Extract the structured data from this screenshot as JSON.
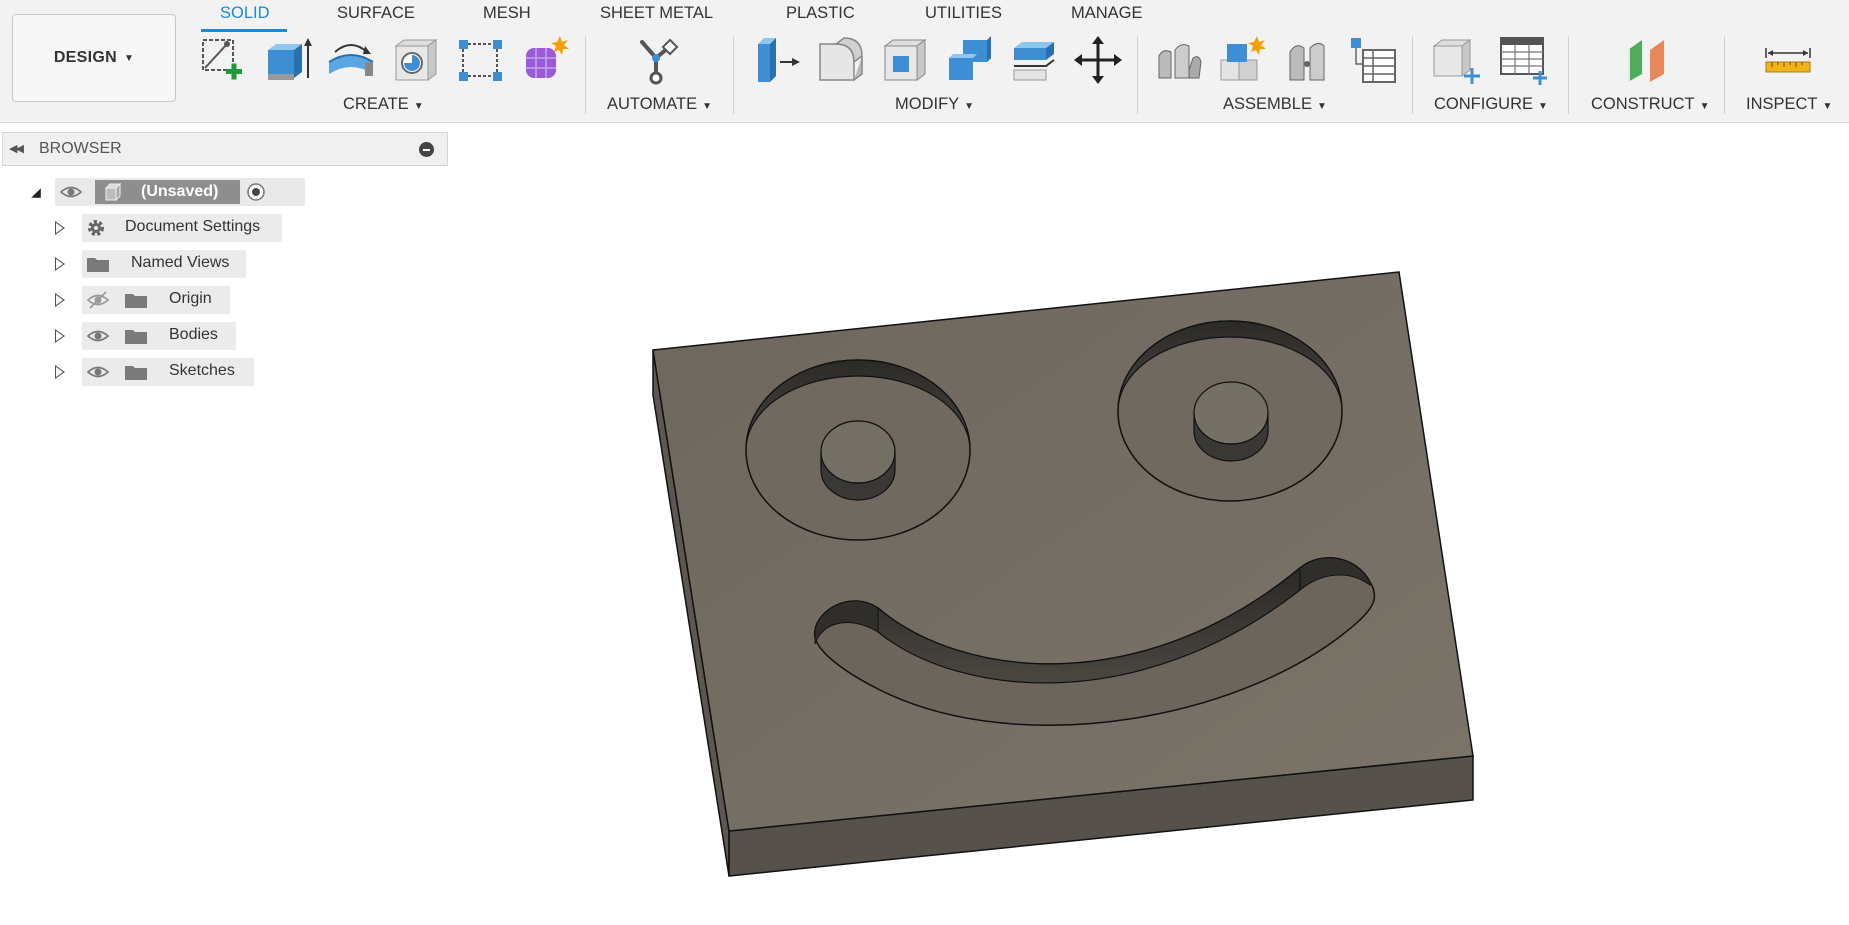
{
  "workspace": {
    "label": "DESIGN"
  },
  "tabs": [
    {
      "label": "SOLID",
      "active": true
    },
    {
      "label": "SURFACE",
      "active": false
    },
    {
      "label": "MESH",
      "active": false
    },
    {
      "label": "SHEET METAL",
      "active": false
    },
    {
      "label": "PLASTIC",
      "active": false
    },
    {
      "label": "UTILITIES",
      "active": false
    },
    {
      "label": "MANAGE",
      "active": false
    }
  ],
  "groups": {
    "create": "CREATE",
    "automate": "AUTOMATE",
    "modify": "MODIFY",
    "assemble": "ASSEMBLE",
    "configure": "CONFIGURE",
    "construct": "CONSTRUCT",
    "inspect": "INSPECT"
  },
  "tools": {
    "create": [
      "create-sketch-icon",
      "extrude-icon",
      "revolve-icon",
      "hole-icon",
      "pattern-icon",
      "create-form-icon"
    ],
    "automate": [
      "automate-icon"
    ],
    "modify": [
      "press-pull-icon",
      "fillet-icon",
      "shell-icon",
      "combine-icon",
      "offset-face-icon",
      "move-icon"
    ],
    "assemble": [
      "joint-icon",
      "new-component-icon",
      "as-built-joint-icon",
      "table-icon"
    ],
    "configure": [
      "configure-icon",
      "configuration-table-icon"
    ],
    "construct": [
      "offset-plane-icon"
    ],
    "inspect": [
      "measure-icon"
    ]
  },
  "browser": {
    "title": "BROWSER",
    "root": "(Unsaved)",
    "items": [
      {
        "label": "Document Settings",
        "icon": "gear-icon"
      },
      {
        "label": "Named Views",
        "icon": "folder-icon"
      },
      {
        "label": "Origin",
        "icon": "folder-icon",
        "visibility": "hidden"
      },
      {
        "label": "Bodies",
        "icon": "folder-icon",
        "visibility": "visible"
      },
      {
        "label": "Sketches",
        "icon": "folder-icon",
        "visibility": "visible"
      }
    ]
  },
  "colors": {
    "accent": "#1a8ad4",
    "body_top": "#777066",
    "body_side": "#55524c"
  }
}
